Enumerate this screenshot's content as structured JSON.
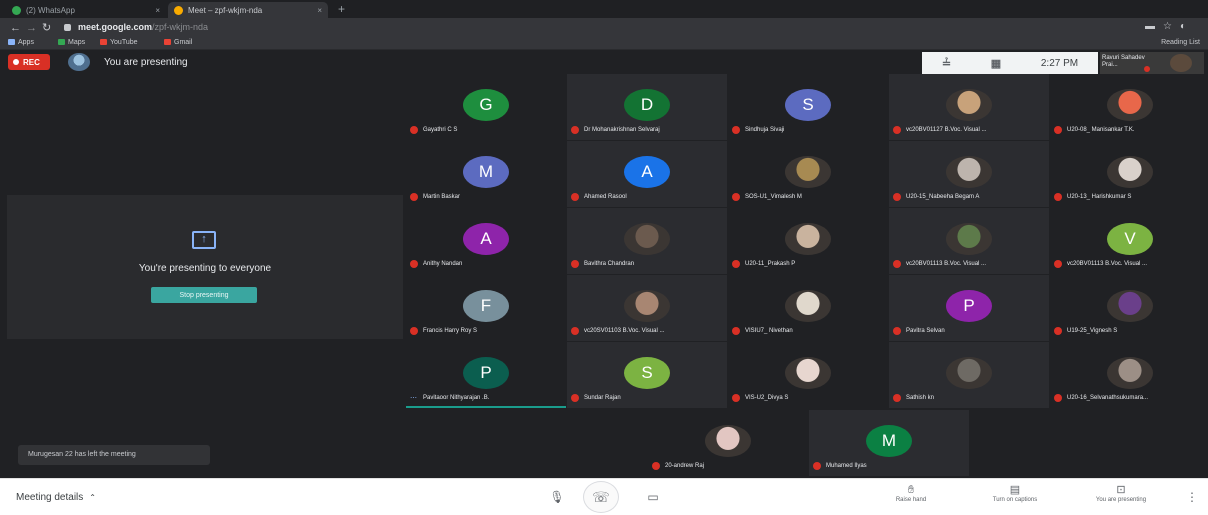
{
  "browser": {
    "tabs": [
      {
        "label": "(2) WhatsApp",
        "close": "×"
      },
      {
        "label": "Meet – zpf-wkjm-nda",
        "close": "×"
      }
    ],
    "new_tab": "+",
    "url_main": "meet.google.com",
    "url_rest": "/zpf-wkjm-nda",
    "bookmarks": [
      "Apps",
      "Maps",
      "YouTube",
      "Gmail"
    ],
    "reading_list": "Reading List"
  },
  "header": {
    "rec_label": "REC",
    "presenting_label": "You are presenting",
    "time": "2:27 PM",
    "self_name": "Ravuri Sahadev Prai..."
  },
  "present_panel": {
    "title": "You're presenting to everyone",
    "stop_button": "Stop presenting"
  },
  "toast": "Murugesan 22 has left the meeting",
  "participants": [
    {
      "name": "Gayathri C S",
      "initial": "G",
      "color": "#1e8e3e"
    },
    {
      "name": "Dr Mohanakrishnan Selvaraj",
      "initial": "D",
      "color": "#137333"
    },
    {
      "name": "Sindhuja Sivaji",
      "initial": "S",
      "color": "#5c6bc0"
    },
    {
      "name": "vc20BV01127 B.Voc. Visual ...",
      "initial": "",
      "color": "#c8a27a"
    },
    {
      "name": "U20-08_ Manisankar T.K.",
      "initial": "",
      "color": "#e8674a"
    },
    {
      "name": "Martin Baskar",
      "initial": "M",
      "color": "#5c6bc0"
    },
    {
      "name": "Ahamed Rasool",
      "initial": "A",
      "color": "#1a73e8"
    },
    {
      "name": "SOS-U1_Vimalesh M",
      "initial": "",
      "color": "#a78a52"
    },
    {
      "name": "U20-15_Nabeeha Begam A",
      "initial": "",
      "color": "#bdb4ad"
    },
    {
      "name": "U20-13_ Harishkumar S",
      "initial": "",
      "color": "#d9d1cb"
    },
    {
      "name": "Anithy Nandan",
      "initial": "A",
      "color": "#8e24aa"
    },
    {
      "name": "Bavithra Chandran",
      "initial": "",
      "color": "#6b5a4e"
    },
    {
      "name": "U20-11_Prakash P",
      "initial": "",
      "color": "#c9b39e"
    },
    {
      "name": "vc20BV01113 B.Voc. Visual ...",
      "initial": "",
      "color": "#5d7a4a"
    },
    {
      "name": "vc20BV01113 B.Voc. Visual ...",
      "initial": "V",
      "color": "#7cb342"
    },
    {
      "name": "Francis Harry Roy S",
      "initial": "F",
      "color": "#78909c"
    },
    {
      "name": "vc20SV01103 B.Voc. Visual ...",
      "initial": "",
      "color": "#a88672"
    },
    {
      "name": "VISIU7_ Nivethan",
      "initial": "",
      "color": "#e0d8cc"
    },
    {
      "name": "Pavitra Selvan",
      "initial": "P",
      "color": "#8e24aa"
    },
    {
      "name": "U19-25_Vignesh S",
      "initial": "",
      "color": "#6a3f8a"
    },
    {
      "name": "Pavitaoor Nithyarajan .B.",
      "initial": "P",
      "color": "#0b5e4f",
      "speaking": true
    },
    {
      "name": "Sundar Rajan",
      "initial": "S",
      "color": "#7cb342"
    },
    {
      "name": "VIS-U2_Divya S",
      "initial": "",
      "color": "#e7d6cf"
    },
    {
      "name": "Sathish kn",
      "initial": "",
      "color": "#6e6a64"
    },
    {
      "name": "U20-16_Selvanathsukumara...",
      "initial": "",
      "color": "#9c8f86"
    },
    {
      "name": "20-andrew Raj",
      "initial": "",
      "color": "#e2c6c2"
    },
    {
      "name": "Muhamed Ilyas",
      "initial": "M",
      "color": "#0b8043"
    }
  ],
  "bottom": {
    "meeting_details": "Meeting details",
    "raise_hand": "Raise hand",
    "captions": "Turn on captions",
    "presenting": "You are presenting"
  },
  "icons": [
    "lock-icon",
    "mic-icon",
    "hangup-icon",
    "camera-icon",
    "hand-icon",
    "captions-icon",
    "present-icon",
    "more-icon",
    "chevron-up-icon"
  ]
}
